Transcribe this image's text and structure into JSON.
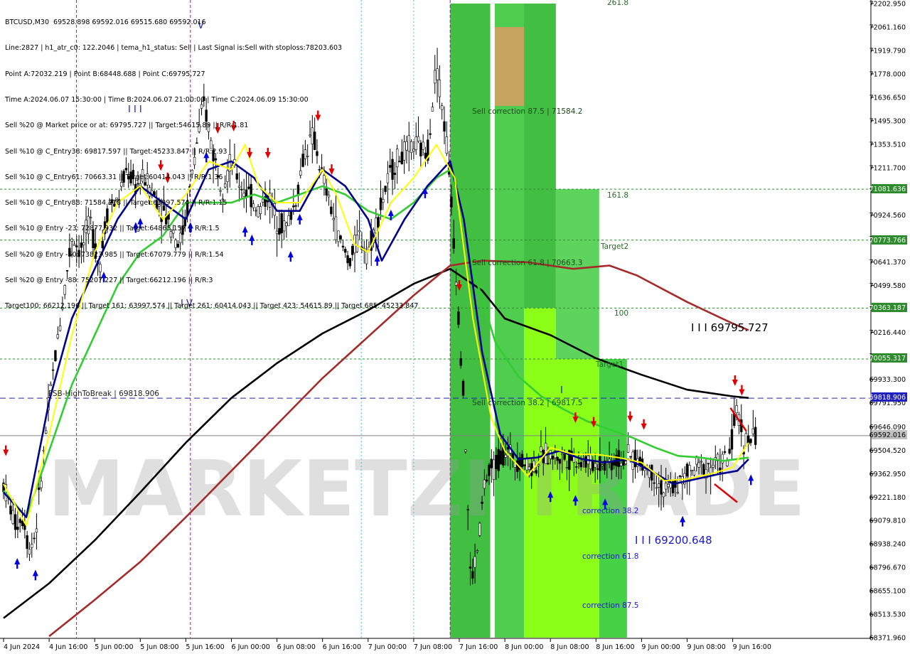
{
  "info": {
    "lines": [
      "BTCUSD,M30  69528.898 69592.016 69515.680 69592.016",
      "Line:2827 | h1_atr_c0: 122.2046 | tema_h1_status: Sell | Last Signal is:Sell with stoploss:78203.603",
      "Point A:72032.219 | Point B:68448.688 | Point C:69795.727",
      "Time A:2024.06.07 15:30:00 | Time B:2024.06.07 21:00:00 | Time C:2024.06.09 15:30:00",
      "Sell %20 @ Market price or at: 69795.727 || Target:54615.89 || R/R:1.81",
      "Sell %10 @ C_Entry38: 69817.597 || Target:45233.847 || R/R:2.93",
      "Sell %10 @ C_Entry61: 70663.31 || Target:60414.043 || R/R:1.36",
      "Sell %10 @ C_Entry88: 71584.278 || Target:63997.574 || R/R:1.15",
      "Sell %10 @ Entry -23: 72877.932 || Target:64865.157 || R/R:1.5",
      "Sell %20 @ Entry -50: 73823.985 || Target:67079.779 || R/R:1.54",
      "Sell %20 @ Entry -88: 75207.227 || Target:66212.196 || R/R:3",
      "Target100: 66212.196 || Target 161: 63997.574 || Target 261: 60414.043 || Target 423: 54615.89 || Target 685: 45233.847"
    ]
  },
  "watermark": "MARKETZI TRADE",
  "price_axis": [
    "72202.950",
    "72061.160",
    "71919.790",
    "71778.000",
    "71636.650",
    "71495.300",
    "71353.510",
    "71211.700",
    "71070.350",
    "70924.560",
    "70782.770",
    "70641.370",
    "70499.580",
    "70358.230",
    "70216.440",
    "70075.090",
    "69933.300",
    "69791.950",
    "69646.090",
    "69504.520",
    "69362.950",
    "69221.180",
    "69079.810",
    "68938.240",
    "68796.670",
    "68655.100",
    "68513.530",
    "68371.960"
  ],
  "time_axis": [
    "4 Jun 2024",
    "4 Jun 16:00",
    "5 Jun 00:00",
    "5 Jun 08:00",
    "5 Jun 16:00",
    "6 Jun 00:00",
    "6 Jun 08:00",
    "6 Jun 16:00",
    "7 Jun 00:00",
    "7 Jun 08:00",
    "7 Jun 16:00",
    "8 Jun 00:00",
    "8 Jun 08:00",
    "8 Jun 16:00",
    "9 Jun 00:00",
    "9 Jun 08:00",
    "9 Jun 16:00"
  ],
  "price_tags": {
    "level_71081": "71081.636",
    "level_70773": "70773.766",
    "level_70363": "70363.187",
    "level_70055": "70055.317",
    "high_to_break": "69818.906",
    "current": "69592.016"
  },
  "labels": {
    "high_to_break": "FSB-HighToBreak | 69818.906",
    "sell_corr_875": "Sell correction 87.5 | 71584.2",
    "sell_corr_618": "Sell correction 61.8 | 70663.3",
    "sell_corr_382": "Sell correction 38.2 | 69817.5",
    "corr_382": "correction 38.2",
    "corr_618": "correction 61.8",
    "corr_875": "correction 87.5",
    "fib_2618": "261.8",
    "fib_1618": "161.8",
    "fib_100": "100",
    "target1": "Target1",
    "target2": "Target2",
    "point_c": "I I I 69795.727",
    "point_b": "I I I 69200.648",
    "wave_iii": "I I I",
    "wave_iv": "I V",
    "wave_v": "V",
    "wave_i": "I"
  },
  "chart_data": {
    "type": "candlestick",
    "symbol": "BTCUSD",
    "timeframe": "M30",
    "ohlc_last": {
      "open": 69528.898,
      "high": 69592.016,
      "low": 69515.68,
      "close": 69592.016
    },
    "ylim": [
      68371.96,
      72202.95
    ],
    "x_ticks": [
      "4 Jun 2024",
      "4 Jun 16:00",
      "5 Jun 00:00",
      "5 Jun 08:00",
      "5 Jun 16:00",
      "6 Jun 00:00",
      "6 Jun 08:00",
      "6 Jun 16:00",
      "7 Jun 00:00",
      "7 Jun 08:00",
      "7 Jun 16:00",
      "8 Jun 00:00",
      "8 Jun 08:00",
      "8 Jun 16:00",
      "9 Jun 00:00",
      "9 Jun 08:00",
      "9 Jun 16:00"
    ],
    "x_range": [
      0,
      16.5
    ],
    "horizontal_levels": [
      {
        "price": 71081.636,
        "style": "dashed",
        "color": "#2e8b2e"
      },
      {
        "price": 70773.766,
        "style": "dashed",
        "color": "#2e8b2e"
      },
      {
        "price": 70363.187,
        "style": "dashed",
        "color": "#2e8b2e"
      },
      {
        "price": 70055.317,
        "style": "dashed",
        "color": "#2e8b2e"
      },
      {
        "price": 69818.906,
        "style": "dashed",
        "color": "#2020c0"
      },
      {
        "price": 69592.016,
        "style": "solid",
        "color": "#808080"
      }
    ],
    "candle_path": [
      [
        0,
        69300
      ],
      [
        0.25,
        69060
      ],
      [
        0.45,
        69100
      ],
      [
        0.55,
        68900
      ],
      [
        0.7,
        69000
      ],
      [
        0.85,
        69400
      ],
      [
        1.0,
        69800
      ],
      [
        1.2,
        70200
      ],
      [
        1.35,
        70500
      ],
      [
        1.5,
        70800
      ],
      [
        1.7,
        70700
      ],
      [
        1.9,
        70900
      ],
      [
        2.1,
        70600
      ],
      [
        2.3,
        71000
      ],
      [
        2.5,
        71000
      ],
      [
        2.7,
        71200
      ],
      [
        2.9,
        71100
      ],
      [
        3.1,
        71150
      ],
      [
        3.3,
        71050
      ],
      [
        3.5,
        70950
      ],
      [
        3.7,
        70850
      ],
      [
        3.85,
        70750
      ],
      [
        4.0,
        70900
      ],
      [
        4.2,
        71300
      ],
      [
        4.4,
        71600
      ],
      [
        4.6,
        71300
      ],
      [
        4.8,
        71100
      ],
      [
        5.0,
        71250
      ],
      [
        5.2,
        71100
      ],
      [
        5.4,
        71050
      ],
      [
        5.6,
        70950
      ],
      [
        5.8,
        71050
      ],
      [
        6.0,
        70900
      ],
      [
        6.2,
        70850
      ],
      [
        6.4,
        71000
      ],
      [
        6.6,
        71300
      ],
      [
        6.8,
        71400
      ],
      [
        7.0,
        71150
      ],
      [
        7.2,
        70950
      ],
      [
        7.4,
        70750
      ],
      [
        7.6,
        70650
      ],
      [
        7.8,
        70800
      ],
      [
        8.0,
        70700
      ],
      [
        8.2,
        70900
      ],
      [
        8.4,
        71100
      ],
      [
        8.6,
        71250
      ],
      [
        8.8,
        71300
      ],
      [
        9.0,
        71350
      ],
      [
        9.3,
        71300
      ],
      [
        9.5,
        71850
      ],
      [
        9.75,
        71300
      ],
      [
        9.9,
        70700
      ],
      [
        10.1,
        69800
      ],
      [
        10.25,
        68700
      ],
      [
        10.4,
        68900
      ],
      [
        10.55,
        69300
      ],
      [
        10.75,
        69400
      ],
      [
        11.0,
        69500
      ],
      [
        11.3,
        69450
      ],
      [
        11.6,
        69400
      ],
      [
        11.9,
        69480
      ],
      [
        12.2,
        69460
      ],
      [
        12.6,
        69450
      ],
      [
        13.0,
        69420
      ],
      [
        13.4,
        69440
      ],
      [
        13.8,
        69460
      ],
      [
        14.2,
        69380
      ],
      [
        14.5,
        69250
      ],
      [
        14.8,
        69300
      ],
      [
        15.2,
        69400
      ],
      [
        15.6,
        69420
      ],
      [
        15.9,
        69450
      ],
      [
        16.1,
        69750
      ],
      [
        16.25,
        69550
      ],
      [
        16.5,
        69592
      ]
    ],
    "series": [
      {
        "color": "#000000",
        "points": [
          [
            0,
            68490
          ],
          [
            1,
            68700
          ],
          [
            2,
            68960
          ],
          [
            3,
            69250
          ],
          [
            4,
            69550
          ],
          [
            5,
            69820
          ],
          [
            6,
            70030
          ],
          [
            7,
            70210
          ],
          [
            8,
            70350
          ],
          [
            9,
            70510
          ],
          [
            9.8,
            70600
          ],
          [
            10.5,
            70470
          ],
          [
            11,
            70300
          ],
          [
            12,
            70200
          ],
          [
            13,
            70060
          ],
          [
            14,
            69960
          ],
          [
            15,
            69870
          ],
          [
            16,
            69830
          ],
          [
            16.35,
            69820
          ]
        ]
      },
      {
        "color": "#a52a2a",
        "points": [
          [
            1,
            68380
          ],
          [
            2,
            68600
          ],
          [
            3,
            68830
          ],
          [
            4,
            69100
          ],
          [
            5,
            69380
          ],
          [
            6,
            69660
          ],
          [
            7,
            69940
          ],
          [
            8,
            70190
          ],
          [
            9,
            70440
          ],
          [
            9.8,
            70620
          ],
          [
            10.5,
            70650
          ],
          [
            11.5,
            70640
          ],
          [
            12.5,
            70600
          ],
          [
            13.3,
            70620
          ],
          [
            13.9,
            70560
          ],
          [
            15,
            70400
          ],
          [
            16,
            70270
          ],
          [
            16.35,
            70230
          ]
        ]
      },
      {
        "color": "#32cd32",
        "points": [
          [
            0,
            69260
          ],
          [
            0.5,
            69100
          ],
          [
            1,
            69500
          ],
          [
            1.5,
            69900
          ],
          [
            2,
            70200
          ],
          [
            2.5,
            70500
          ],
          [
            3,
            70700
          ],
          [
            3.5,
            70800
          ],
          [
            4,
            71000
          ],
          [
            4.5,
            71000
          ],
          [
            5,
            71000
          ],
          [
            5.5,
            71050
          ],
          [
            6,
            71000
          ],
          [
            6.5,
            71050
          ],
          [
            7,
            71100
          ],
          [
            7.5,
            71050
          ],
          [
            8,
            70950
          ],
          [
            8.5,
            70900
          ],
          [
            9,
            71000
          ],
          [
            9.5,
            71150
          ],
          [
            9.8,
            71200
          ],
          [
            10.3,
            70600
          ],
          [
            10.8,
            70150
          ],
          [
            11.3,
            69950
          ],
          [
            11.8,
            69830
          ],
          [
            12.3,
            69750
          ],
          [
            12.8,
            69680
          ],
          [
            13.3,
            69630
          ],
          [
            13.8,
            69580
          ],
          [
            14.3,
            69520
          ],
          [
            14.8,
            69470
          ],
          [
            15.3,
            69460
          ],
          [
            15.8,
            69440
          ],
          [
            16.35,
            69460
          ]
        ]
      },
      {
        "color": "#00008b",
        "points": [
          [
            0,
            69250
          ],
          [
            0.5,
            69100
          ],
          [
            1,
            69800
          ],
          [
            1.5,
            70300
          ],
          [
            2,
            70600
          ],
          [
            2.5,
            70900
          ],
          [
            3,
            71100
          ],
          [
            3.5,
            71000
          ],
          [
            4,
            70900
          ],
          [
            4.5,
            71200
          ],
          [
            5,
            71250
          ],
          [
            5.5,
            71150
          ],
          [
            6,
            70950
          ],
          [
            6.5,
            70950
          ],
          [
            7,
            71200
          ],
          [
            7.5,
            71100
          ],
          [
            8,
            70900
          ],
          [
            8.3,
            70650
          ],
          [
            8.8,
            70900
          ],
          [
            9.3,
            71100
          ],
          [
            9.8,
            71250
          ],
          [
            10.1,
            70900
          ],
          [
            10.5,
            70100
          ],
          [
            10.9,
            69600
          ],
          [
            11.3,
            69450
          ],
          [
            11.7,
            69460
          ],
          [
            12.2,
            69500
          ],
          [
            12.7,
            69450
          ],
          [
            13.2,
            69430
          ],
          [
            13.7,
            69450
          ],
          [
            14.2,
            69380
          ],
          [
            14.7,
            69300
          ],
          [
            15.2,
            69330
          ],
          [
            15.7,
            69360
          ],
          [
            16.1,
            69380
          ],
          [
            16.35,
            69450
          ]
        ]
      },
      {
        "color": "#ffff00",
        "points": [
          [
            0,
            69300
          ],
          [
            0.5,
            69050
          ],
          [
            1,
            69600
          ],
          [
            1.5,
            70200
          ],
          [
            2,
            70700
          ],
          [
            2.5,
            71000
          ],
          [
            3,
            71100
          ],
          [
            3.5,
            70900
          ],
          [
            4,
            71050
          ],
          [
            4.5,
            71250
          ],
          [
            5,
            71200
          ],
          [
            5.3,
            71350
          ],
          [
            5.6,
            71100
          ],
          [
            6,
            71000
          ],
          [
            6.5,
            71000
          ],
          [
            7,
            71200
          ],
          [
            7.3,
            71050
          ],
          [
            7.7,
            70750
          ],
          [
            8,
            70700
          ],
          [
            8.5,
            71000
          ],
          [
            9,
            71150
          ],
          [
            9.5,
            71350
          ],
          [
            9.9,
            71150
          ],
          [
            10.3,
            70300
          ],
          [
            10.7,
            69700
          ],
          [
            11,
            69500
          ],
          [
            11.5,
            69350
          ],
          [
            12,
            69520
          ],
          [
            12.5,
            69480
          ],
          [
            13,
            69480
          ],
          [
            13.5,
            69460
          ],
          [
            14,
            69430
          ],
          [
            14.5,
            69320
          ],
          [
            15,
            69330
          ],
          [
            15.5,
            69360
          ],
          [
            16,
            69400
          ],
          [
            16.35,
            69550
          ]
        ]
      }
    ],
    "zones": [
      {
        "x0": 9.8,
        "x1": 10.68,
        "y0": 68371.96,
        "y1": 72202.95,
        "color": "#2eb82e"
      },
      {
        "x0": 10.78,
        "x1": 11.42,
        "y0": 68371.96,
        "y1": 72202.95,
        "color": "#3cc83c"
      },
      {
        "x0": 11.42,
        "x1": 12.12,
        "y0": 70363.19,
        "y1": 72202.95,
        "color": "#2eb82e"
      },
      {
        "x0": 11.42,
        "x1": 12.12,
        "y0": 68371.96,
        "y1": 70363.19,
        "color": "#7fff00"
      },
      {
        "x0": 12.12,
        "x1": 13.07,
        "y0": 70055.32,
        "y1": 71081.64,
        "color": "#4ccf4c"
      },
      {
        "x0": 12.12,
        "x1": 13.07,
        "y0": 68371.96,
        "y1": 70055.32,
        "color": "#7fff00"
      },
      {
        "x0": 13.07,
        "x1": 13.68,
        "y0": 68371.96,
        "y1": 70055.32,
        "color": "#32cd32"
      },
      {
        "x0": 10.78,
        "x1": 11.42,
        "y0": 71584.2,
        "y1": 72061.16,
        "color": "#d2a060"
      }
    ]
  }
}
